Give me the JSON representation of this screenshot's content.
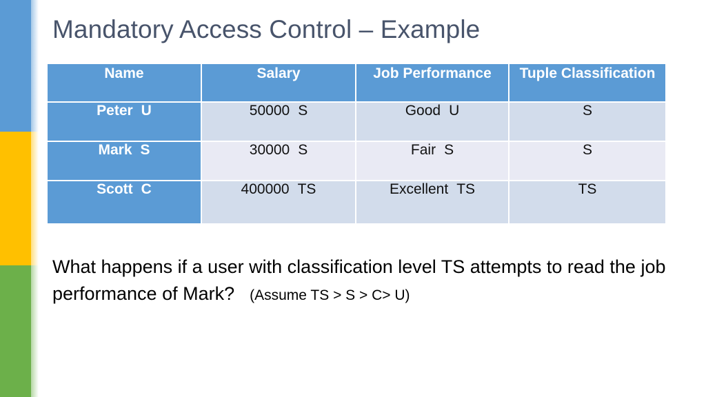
{
  "slide": {
    "title": "Mandatory Access Control – Example"
  },
  "colors": {
    "accent_blue": "#5b9bd5",
    "accent_yellow": "#ffc000",
    "accent_green": "#6cb04a",
    "title_text": "#48546b",
    "row_odd_bg": "#d2dceb",
    "row_even_bg": "#e9eaf4"
  },
  "table": {
    "headers": [
      "Name",
      "Salary",
      "Job Performance",
      "Tuple Classification"
    ],
    "rows": [
      {
        "name": "Peter",
        "name_label": "U",
        "salary": "50000",
        "salary_label": "S",
        "performance": "Good",
        "performance_label": "U",
        "tuple_classification": "S"
      },
      {
        "name": "Mark",
        "name_label": "S",
        "salary": "30000",
        "salary_label": "S",
        "performance": "Fair",
        "performance_label": "S",
        "tuple_classification": "S"
      },
      {
        "name": "Scott",
        "name_label": "C",
        "salary": "400000",
        "salary_label": "TS",
        "performance": "Excellent",
        "performance_label": "TS",
        "tuple_classification": "TS"
      }
    ]
  },
  "body": {
    "line1": "What happens if a user with classification level TS attempts to",
    "line2": "read the job performance of Mark?",
    "note": "(Assume TS > S > C> U)"
  }
}
